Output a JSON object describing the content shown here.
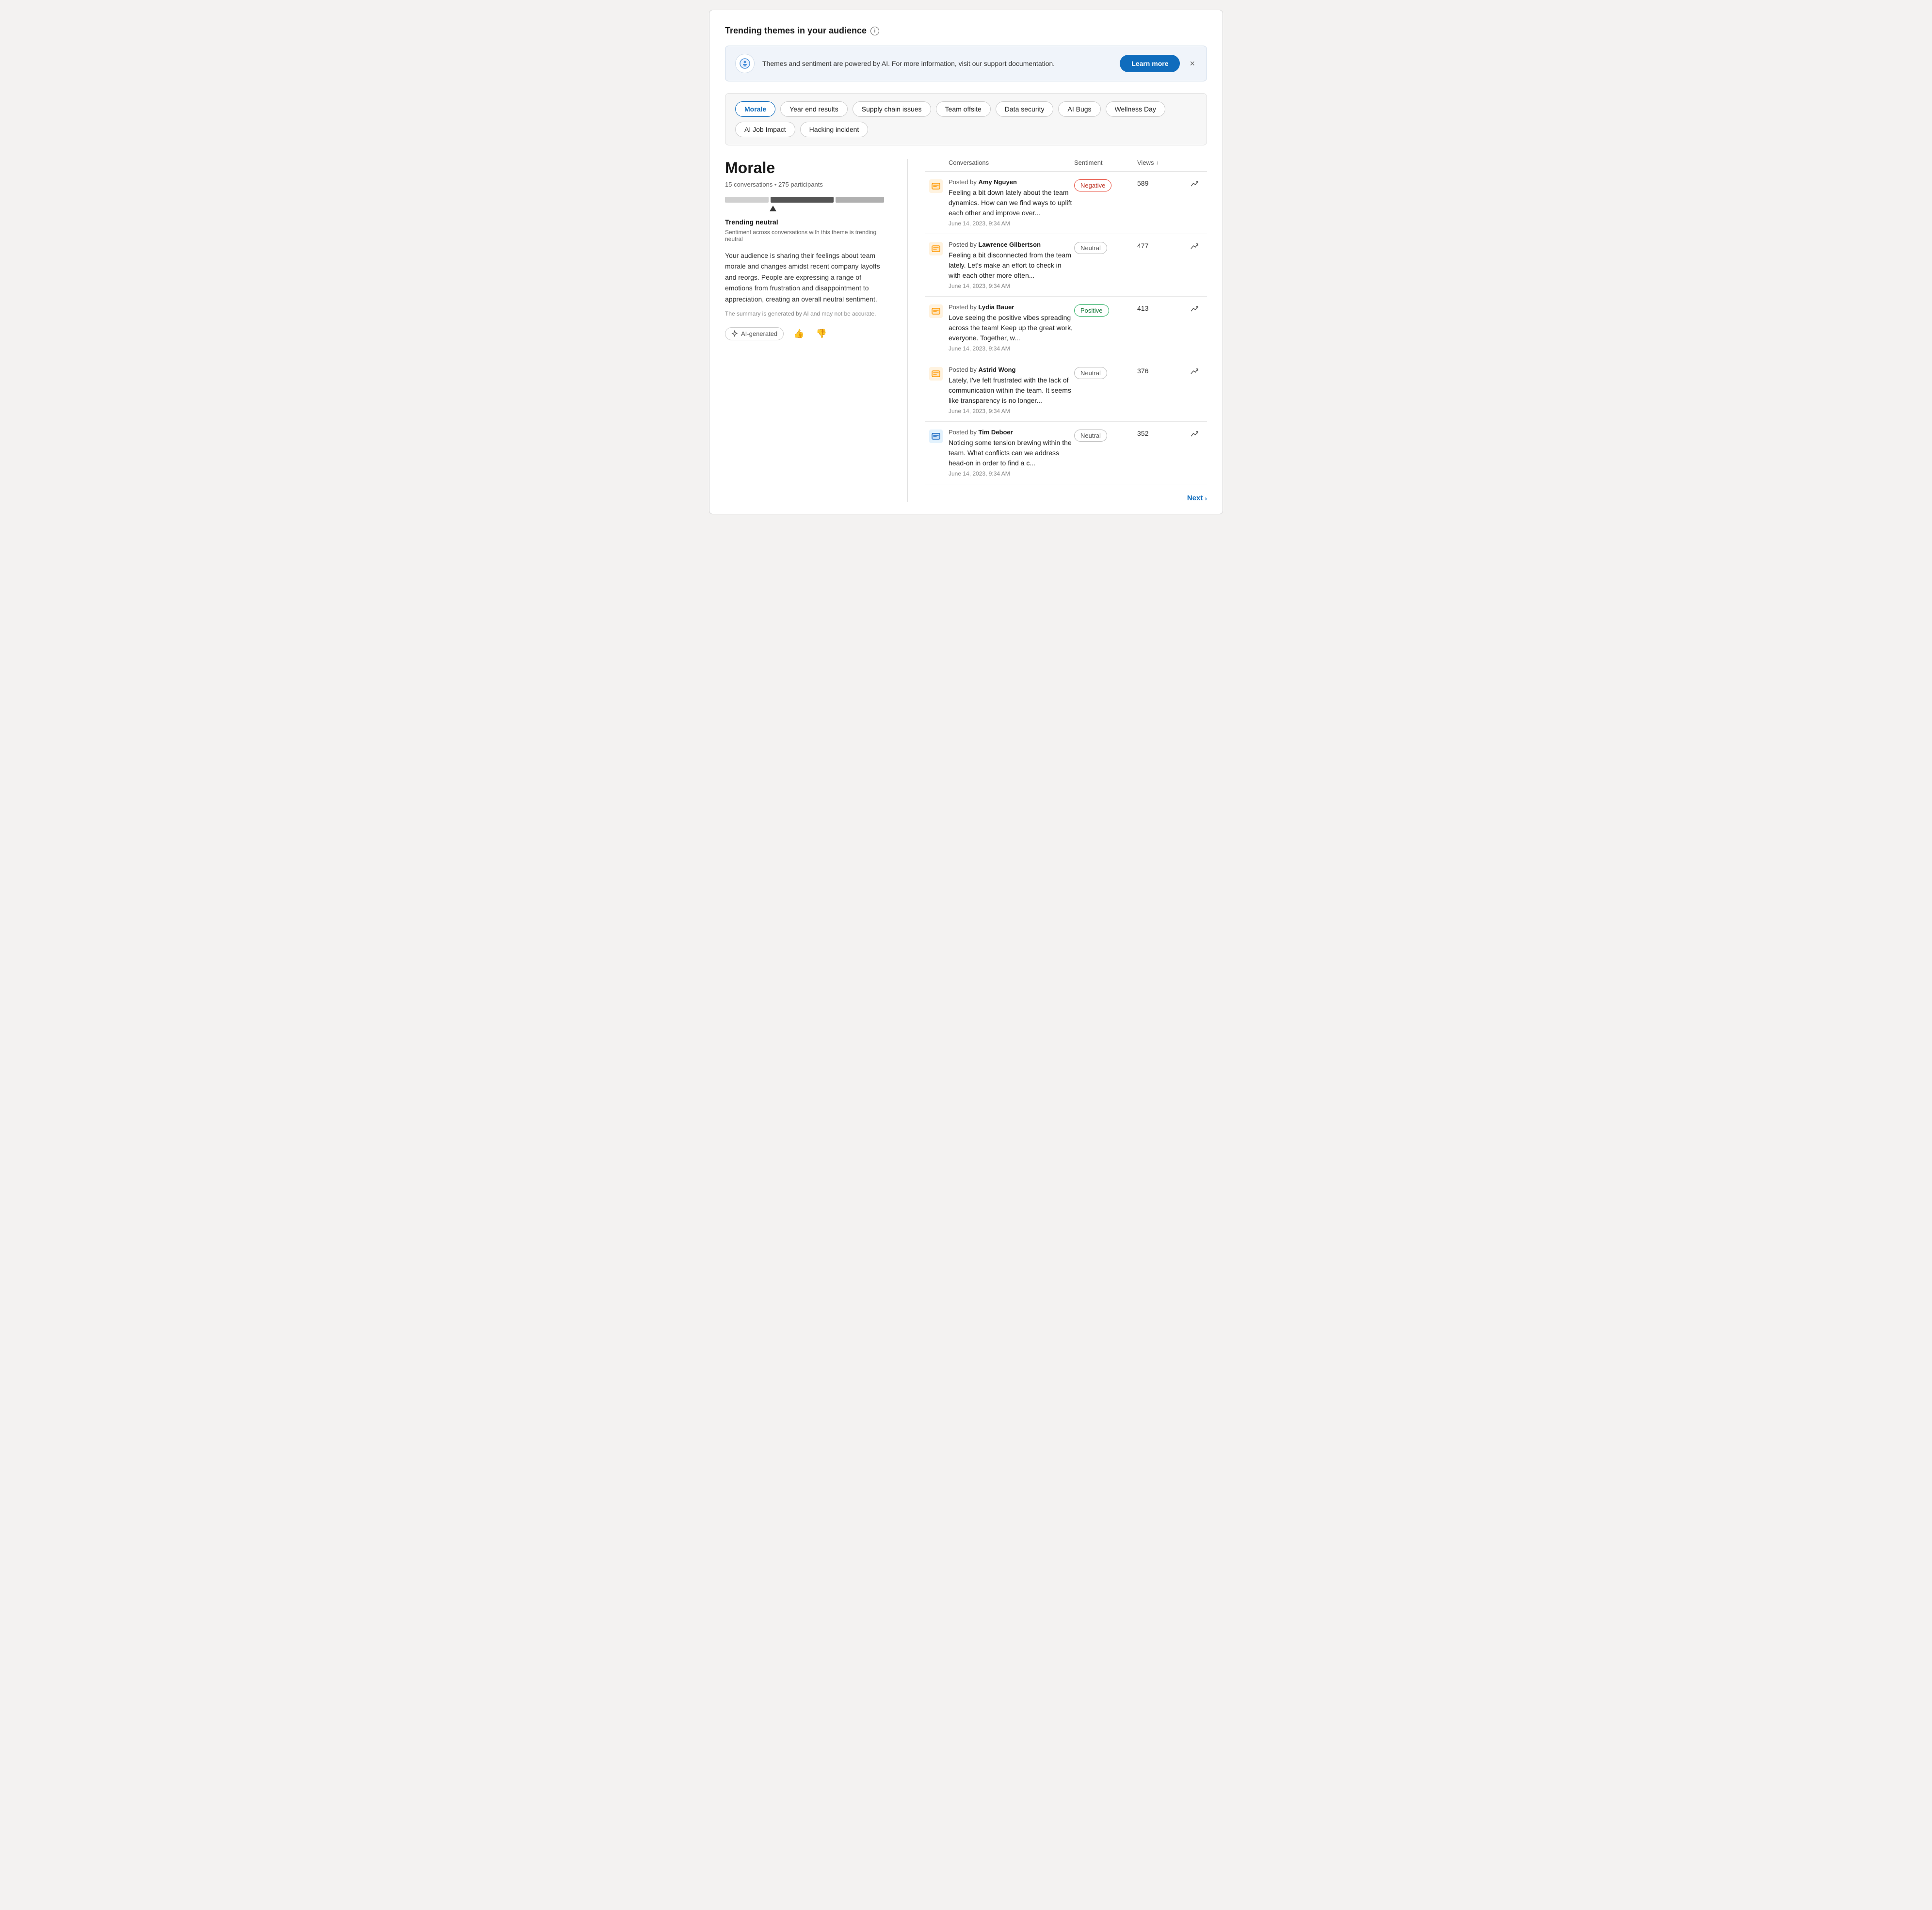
{
  "page": {
    "title": "Trending themes in your audience"
  },
  "banner": {
    "text": "Themes and sentiment are powered by AI. For more information, visit our support documentation.",
    "learn_more_label": "Learn more",
    "close_label": "×"
  },
  "themes": {
    "items": [
      {
        "id": "morale",
        "label": "Morale",
        "active": true
      },
      {
        "id": "year-end-results",
        "label": "Year end results",
        "active": false
      },
      {
        "id": "supply-chain-issues",
        "label": "Supply chain issues",
        "active": false
      },
      {
        "id": "team-offsite",
        "label": "Team offsite",
        "active": false
      },
      {
        "id": "data-security",
        "label": "Data security",
        "active": false
      },
      {
        "id": "ai-bugs",
        "label": "AI Bugs",
        "active": false
      },
      {
        "id": "wellness-day",
        "label": "Wellness Day",
        "active": false
      },
      {
        "id": "ai-job-impact",
        "label": "AI Job Impact",
        "active": false
      },
      {
        "id": "hacking-incident",
        "label": "Hacking incident",
        "active": false
      }
    ]
  },
  "detail": {
    "theme_title": "Morale",
    "meta": "15 conversations • 275 participants",
    "trending_title": "Trending neutral",
    "trending_sub": "Sentiment across conversations with this theme is trending neutral",
    "summary": "Your audience is sharing their feelings about team morale and changes amidst recent company layoffs and reorgs. People are expressing a range of emotions from frustration and disappointment to appreciation, creating an overall neutral sentiment.",
    "disclaimer": "The summary is generated by AI and may not be accurate.",
    "ai_label": "AI-generated",
    "thumbup_label": "👍",
    "thumbdown_label": "👎"
  },
  "table": {
    "col_conversations": "Conversations",
    "col_sentiment": "Sentiment",
    "col_views": "Views",
    "rows": [
      {
        "author": "Amy Nguyen",
        "prefix": "Posted by",
        "text": "Feeling a bit down lately about the team dynamics. How can we find ways to uplift each other and improve over...",
        "date": "June 14, 2023, 9:34 AM",
        "sentiment": "Negative",
        "sentiment_type": "negative",
        "views": "589",
        "icon_type": "orange"
      },
      {
        "author": "Lawrence Gilbertson",
        "prefix": "Posted by",
        "text": "Feeling a bit disconnected from the team lately. Let's make an effort to check in with each other more often...",
        "date": "June 14, 2023, 9:34 AM",
        "sentiment": "Neutral",
        "sentiment_type": "neutral",
        "views": "477",
        "icon_type": "orange"
      },
      {
        "author": "Lydia Bauer",
        "prefix": "Posted by",
        "text": "Love seeing the positive vibes spreading across the team! Keep up the great work, everyone. Together, w...",
        "date": "June 14, 2023, 9:34 AM",
        "sentiment": "Positive",
        "sentiment_type": "positive",
        "views": "413",
        "icon_type": "orange"
      },
      {
        "author": "Astrid Wong",
        "prefix": "Posted by",
        "text": "Lately, I've felt frustrated with the lack of communication within the team. It seems like transparency is no longer...",
        "date": "June 14, 2023, 9:34 AM",
        "sentiment": "Neutral",
        "sentiment_type": "neutral",
        "views": "376",
        "icon_type": "orange"
      },
      {
        "author": "Tim Deboer",
        "prefix": "Posted by",
        "text": "Noticing some tension brewing within the team. What conflicts can we address head-on in order to find a c...",
        "date": "June 14, 2023, 9:34 AM",
        "sentiment": "Neutral",
        "sentiment_type": "neutral",
        "views": "352",
        "icon_type": "blue"
      }
    ]
  },
  "pagination": {
    "next_label": "Next"
  }
}
